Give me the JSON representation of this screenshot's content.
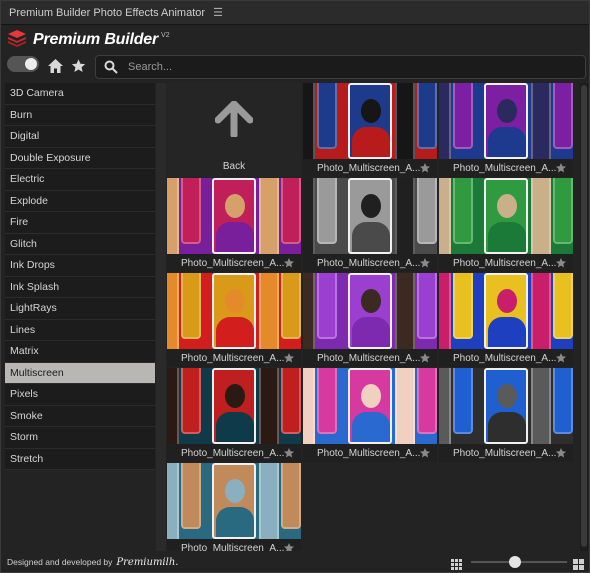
{
  "window": {
    "title": "Premium Builder Photo Effects Animator",
    "menu_icon": "hamburger-icon"
  },
  "brand": {
    "name": "Premium Builder",
    "version": "V2",
    "logo_icon": "stack-logo-icon",
    "logo_color": "#e8373b"
  },
  "toolbar": {
    "toggle_on": true,
    "home_icon": "home-icon",
    "favorites_icon": "star-icon"
  },
  "search": {
    "placeholder": "Search...",
    "value": ""
  },
  "sidebar": {
    "items": [
      {
        "label": "3D Camera"
      },
      {
        "label": "Burn"
      },
      {
        "label": "Digital"
      },
      {
        "label": "Double Exposure"
      },
      {
        "label": "Electric"
      },
      {
        "label": "Explode"
      },
      {
        "label": "Fire"
      },
      {
        "label": "Glitch"
      },
      {
        "label": "Ink Drops"
      },
      {
        "label": "Ink Splash"
      },
      {
        "label": "LightRays"
      },
      {
        "label": "Lines"
      },
      {
        "label": "Matrix"
      },
      {
        "label": "Multiscreen"
      },
      {
        "label": "Pixels"
      },
      {
        "label": "Smoke"
      },
      {
        "label": "Storm"
      },
      {
        "label": "Stretch"
      }
    ],
    "selected": "Multiscreen"
  },
  "grid": {
    "back": {
      "label": "Back",
      "icon": "arrow-up-icon"
    },
    "tiles": [
      {
        "label": "Photo_Multiscreen_A...",
        "colors": [
          "#b81b1b",
          "#1e3a8a",
          "#161616"
        ]
      },
      {
        "label": "Photo_Multiscreen_A...",
        "colors": [
          "#1d3a8f",
          "#7c1fa3",
          "#2a2a5e"
        ]
      },
      {
        "label": "Photo_Multiscreen_A...",
        "colors": [
          "#7a1f9c",
          "#c01f5a",
          "#d6a06a"
        ]
      },
      {
        "label": "Photo_Multiscreen_A...",
        "colors": [
          "#4a4a4a",
          "#9a9a9a",
          "#202020"
        ]
      },
      {
        "label": "Photo_Multiscreen_A...",
        "colors": [
          "#1c7a38",
          "#2f9a3f",
          "#c9b08a"
        ]
      },
      {
        "label": "Photo_Multiscreen_A...",
        "colors": [
          "#d31e1e",
          "#d89a18",
          "#e58a2a"
        ]
      },
      {
        "label": "Photo_Multiscreen_A...",
        "colors": [
          "#7d2ab0",
          "#9b3fd0",
          "#3a2a22"
        ]
      },
      {
        "label": "Photo_Multiscreen_A...",
        "colors": [
          "#1e3fc0",
          "#e8c020",
          "#c91e6a"
        ]
      },
      {
        "label": "Photo_Multiscreen_A...",
        "colors": [
          "#0f3a4a",
          "#c01f1f",
          "#2b1a14"
        ]
      },
      {
        "label": "Photo_Multiscreen_A...",
        "colors": [
          "#2a6ad0",
          "#d63aa0",
          "#f0d0c0"
        ]
      },
      {
        "label": "Photo_Multiscreen_A...",
        "colors": [
          "#2e2e2e",
          "#1f5fd0",
          "#5a5a5a"
        ]
      },
      {
        "label": "Photo_Multiscreen_A...",
        "colors": [
          "#2a6a80",
          "#c08a5a",
          "#8ab0c0"
        ]
      }
    ],
    "star_icon": "star-icon"
  },
  "footer": {
    "credit": "Designed and developed by",
    "logo_text": "Premiumilh.",
    "small_grid_icon": "grid-small-icon",
    "large_grid_icon": "grid-large-icon",
    "zoom_level": 0.45
  }
}
